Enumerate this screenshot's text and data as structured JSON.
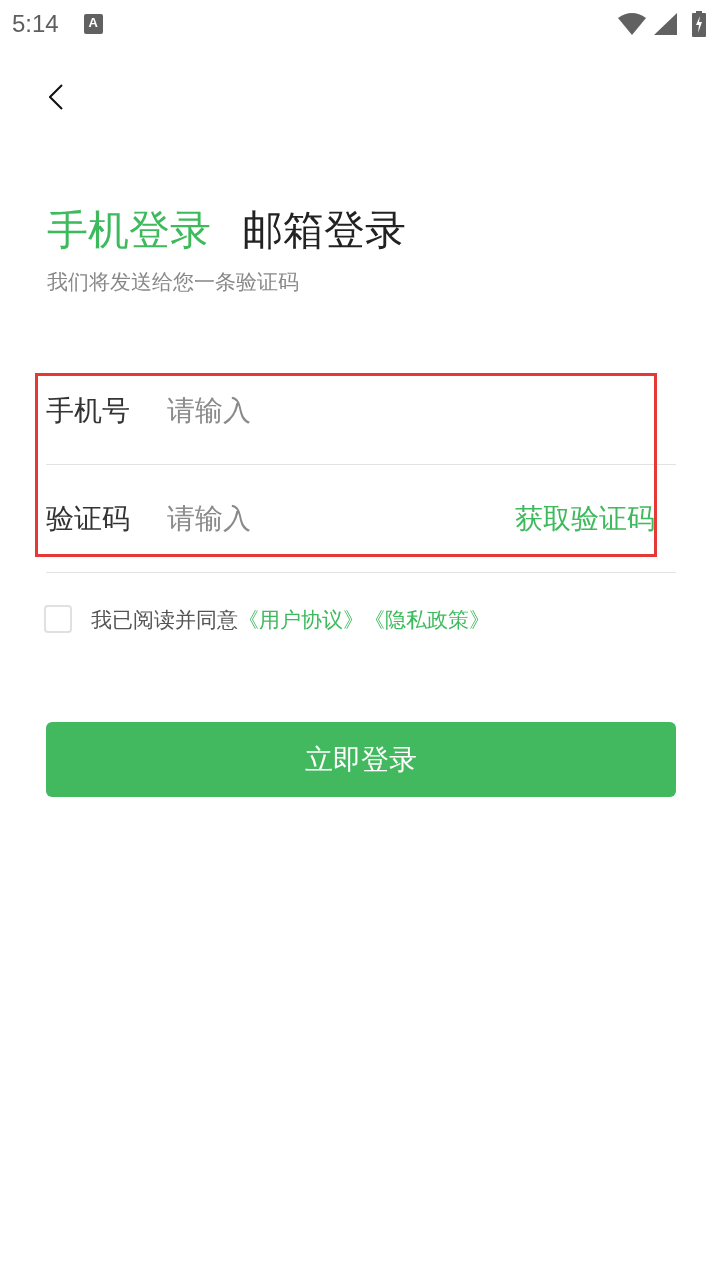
{
  "status_bar": {
    "time": "5:14",
    "notification_glyph": "A"
  },
  "tabs": [
    {
      "label": "手机登录",
      "selected": true
    },
    {
      "label": "邮箱登录",
      "selected": false
    }
  ],
  "subtitle": "我们将发送给您一条验证码",
  "form": {
    "highlighted": true,
    "fields": [
      {
        "label": "手机号",
        "placeholder": "请输入"
      },
      {
        "label": "验证码",
        "placeholder": "请输入",
        "action": "获取验证码"
      }
    ]
  },
  "agreement": {
    "checked": false,
    "text": "我已阅读并同意",
    "links": [
      "《用户协议》",
      "《隐私政策》"
    ]
  },
  "submit_button": "立即登录"
}
